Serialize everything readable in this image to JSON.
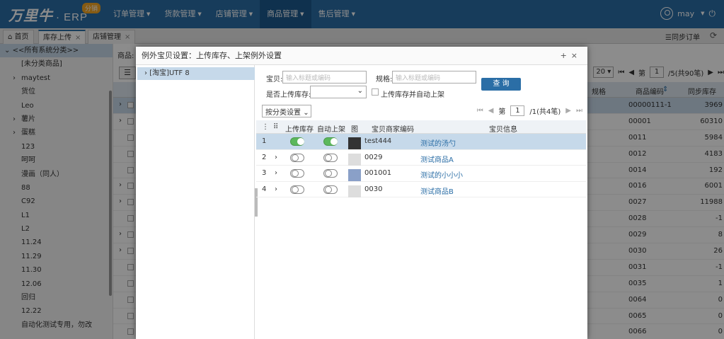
{
  "app": {
    "logo": "万里牛",
    "erp": "· ERP",
    "badge": "分销"
  },
  "nav": [
    "订单管理",
    "货款管理",
    "店铺管理",
    "商品管理",
    "售后管理"
  ],
  "user": {
    "name": "may"
  },
  "tabs": [
    {
      "label": "首页"
    },
    {
      "label": "库存上传"
    },
    {
      "label": "店铺管理"
    }
  ],
  "sync_label": "同步订单",
  "sidebar": {
    "root": "<<所有系统分类>>",
    "items": [
      {
        "label": "[未分类商品]",
        "exp": false
      },
      {
        "label": "maytest",
        "exp": true
      },
      {
        "label": "货位",
        "exp": false
      },
      {
        "label": "Leo",
        "exp": false
      },
      {
        "label": "薯片",
        "exp": true
      },
      {
        "label": "蛋糕",
        "exp": true
      },
      {
        "label": "123",
        "exp": false
      },
      {
        "label": "呵呵",
        "exp": false
      },
      {
        "label": "漫画（同人）",
        "exp": false
      },
      {
        "label": "88",
        "exp": false
      },
      {
        "label": "C92",
        "exp": false
      },
      {
        "label": "L1",
        "exp": false
      },
      {
        "label": "L2",
        "exp": false
      },
      {
        "label": "11.24",
        "exp": false
      },
      {
        "label": "11.29",
        "exp": false
      },
      {
        "label": "11.30",
        "exp": false
      },
      {
        "label": "12.06",
        "exp": false
      },
      {
        "label": "回归",
        "exp": false
      },
      {
        "label": "12.22",
        "exp": false
      },
      {
        "label": "自动化测试专用，勿改",
        "exp": false
      }
    ]
  },
  "main": {
    "prefix": "商品:",
    "page_size": "20",
    "page_label": "第",
    "page": "1",
    "page_total": "/5(共90笔)",
    "headers": {
      "spec": "规格",
      "code": "商品编码",
      "stock": "同步库存"
    },
    "rows": [
      {
        "code": "00000111-1",
        "stock": "3969"
      },
      {
        "code": "00001",
        "stock": "60310"
      },
      {
        "code": "0011",
        "stock": "5984"
      },
      {
        "code": "0012",
        "stock": "4183"
      },
      {
        "code": "0014",
        "stock": "192"
      },
      {
        "code": "0016",
        "stock": "6001"
      },
      {
        "code": "0027",
        "stock": "11988"
      },
      {
        "code": "0028",
        "stock": "-1"
      },
      {
        "code": "0029",
        "stock": "8"
      },
      {
        "code": "0030",
        "stock": "26"
      },
      {
        "code": "0031",
        "stock": "-1"
      },
      {
        "code": "0035",
        "stock": "1"
      },
      {
        "code": "0064",
        "stock": "0"
      },
      {
        "code": "0065",
        "stock": "0"
      },
      {
        "code": "0066",
        "stock": "0"
      }
    ]
  },
  "modal": {
    "title": "例外宝贝设置：上传库存、上架例外设置",
    "tree": "[淘宝]UTF 8",
    "filter": {
      "item_label": "宝贝:",
      "item_ph": "输入标题或编码",
      "spec_label": "规格:",
      "spec_ph": "输入标题或编码",
      "upload_label": "是否上传库存:",
      "auto_label": "上传库存并自动上架",
      "query_label": "查 询",
      "category": "按分类设置"
    },
    "pager": {
      "page_label": "第",
      "page": "1",
      "total": "/1(共4笔)"
    },
    "headers": {
      "upload": "上传库存",
      "auto": "自动上架",
      "img": "图",
      "code": "宝贝商家编码",
      "info": "宝贝信息"
    },
    "rows": [
      {
        "idx": "1",
        "upload": true,
        "auto": true,
        "code": "test444",
        "info": "测试的汤勺"
      },
      {
        "idx": "2",
        "upload": false,
        "auto": false,
        "code": "0029",
        "info": "测试商品A"
      },
      {
        "idx": "3",
        "upload": false,
        "auto": false,
        "code": "001001",
        "info": "测试的小小小"
      },
      {
        "idx": "4",
        "upload": false,
        "auto": false,
        "code": "0030",
        "info": "测试商品B"
      }
    ]
  }
}
